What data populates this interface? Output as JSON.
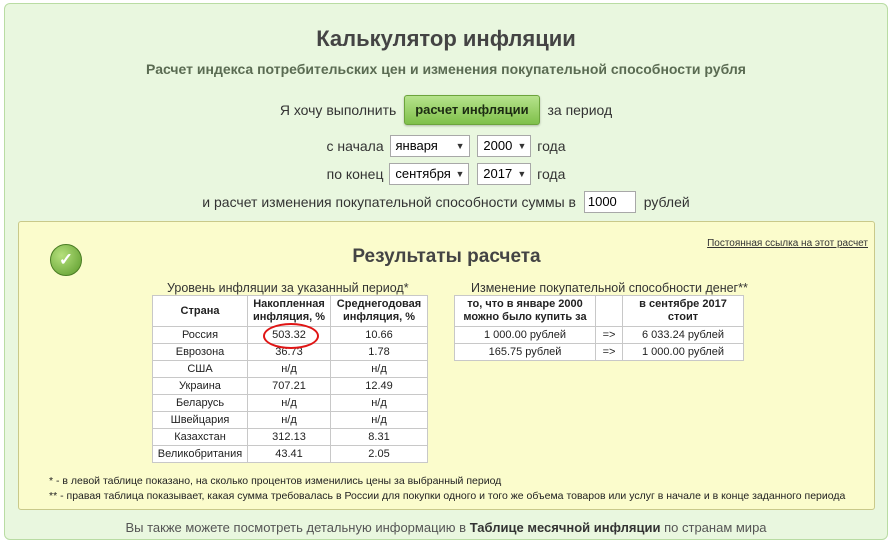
{
  "page": {
    "title": "Калькулятор инфляции",
    "subtitle": "Расчет индекса потребительских цен и изменения покупательной способности рубля"
  },
  "form": {
    "intro": "Я хочу выполнить",
    "calc_button": "расчет инфляции",
    "period_suffix": "за период",
    "start_label": "с начала",
    "start_month": "января",
    "start_year": "2000",
    "year_word": "года",
    "end_label": "по конец",
    "end_month": "сентября",
    "end_year": "2017",
    "sum_label": "и расчет изменения покупательной способности суммы в",
    "sum_value": "1000",
    "currency": "рублей"
  },
  "results": {
    "title": "Результаты расчета",
    "permalink": "Постоянная ссылка на этот расчет",
    "left_caption": "Уровень инфляции за указанный период*",
    "left_headers": [
      "Страна",
      "Накопленная инфляция, %",
      "Среднегодовая инфляция, %"
    ],
    "left_rows": [
      [
        "Россия",
        "503.32",
        "10.66"
      ],
      [
        "Еврозона",
        "36.73",
        "1.78"
      ],
      [
        "США",
        "н/д",
        "н/д"
      ],
      [
        "Украина",
        "707.21",
        "12.49"
      ],
      [
        "Беларусь",
        "н/д",
        "н/д"
      ],
      [
        "Швейцария",
        "н/д",
        "н/д"
      ],
      [
        "Казахстан",
        "312.13",
        "8.31"
      ],
      [
        "Великобритания",
        "43.41",
        "2.05"
      ]
    ],
    "right_caption": "Изменение покупательной способности денег**",
    "right_headers": [
      "то, что в январе 2000 можно было купить за",
      "",
      "в сентябре 2017 стоит"
    ],
    "right_rows": [
      [
        "1 000.00 рублей",
        "=>",
        "6 033.24 рублей"
      ],
      [
        "165.75 рублей",
        "=>",
        "1 000.00 рублей"
      ]
    ],
    "note1": "* - в левой таблице показано, на сколько процентов изменились цены за выбранный период",
    "note2": "** - правая таблица показывает, какая сумма требовалась в России для покупки одного и того же объема товаров или услуг в начале и в конце заданного периода"
  },
  "footer": {
    "prefix": "Вы также можете посмотреть детальную информацию в",
    "link": "Таблице месячной инфляции",
    "suffix": "по странам мира"
  },
  "icons": {
    "result_icon": "check-icon",
    "select_arrow": "chevron-down-icon"
  },
  "colors": {
    "panel_bg": "#e9f7df",
    "results_bg": "#fbfccc",
    "button_green": "#7fc04a",
    "highlight": "#e01515"
  }
}
